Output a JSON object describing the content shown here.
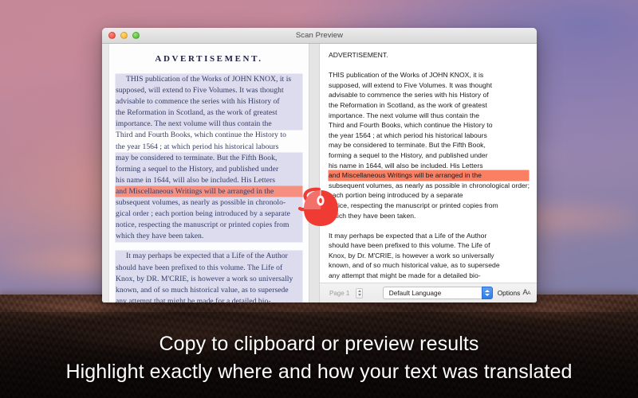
{
  "window": {
    "title": "Scan Preview",
    "traffic_lights": [
      "close-button",
      "minimize-button",
      "zoom-button"
    ]
  },
  "scan_pane": {
    "heading": "ADVERTISEMENT.",
    "paragraphs": [
      {
        "lines": [
          {
            "text": "THIS publication of the Works of JOHN KNOX, it is",
            "highlight": "blue",
            "indent": true
          },
          {
            "text": "supposed, will extend to Five Volumes.   It was thought",
            "highlight": "blue"
          },
          {
            "text": "advisable to commence the series with his History of",
            "highlight": "blue"
          },
          {
            "text": "the Reformation in Scotland, as the work of greatest",
            "highlight": "blue"
          },
          {
            "text": "importance.    The next volume will thus contain the",
            "highlight": "blue"
          },
          {
            "text": "Third and Fourth Books, which continue the History to",
            "highlight": "none"
          },
          {
            "text": "the year 1564 ; at which period his historical labours",
            "highlight": "none"
          },
          {
            "text": "may be considered to terminate.   But the Fifth Book,",
            "highlight": "blue"
          },
          {
            "text": "forming a sequel to the History, and published under",
            "highlight": "blue"
          },
          {
            "text": "his name in 1644, will also be included.   His Letters",
            "highlight": "blue"
          },
          {
            "text": "and Miscellaneous Writings will be arranged in the",
            "highlight": "red"
          },
          {
            "text": "subsequent volumes, as nearly as possible in chronolo-",
            "highlight": "blue"
          },
          {
            "text": "gical order ; each portion being introduced by a separate",
            "highlight": "blue"
          },
          {
            "text": "notice, respecting the manuscript or printed copies from",
            "highlight": "blue"
          },
          {
            "text": "which they have been taken.",
            "highlight": "blue"
          }
        ]
      },
      {
        "lines": [
          {
            "text": "It may perhaps be expected that a Life of the Author",
            "highlight": "blue",
            "indent": true
          },
          {
            "text": "should have been prefixed to this volume.   The Life of",
            "highlight": "blue"
          },
          {
            "text": "Knox, by DR. M'CRIE, is however a work so universally",
            "highlight": "blue"
          },
          {
            "text": "known, and of so much historical value, as to supersede",
            "highlight": "blue"
          },
          {
            "text": "any attempt that might be made for a detailed bio-",
            "highlight": "blue"
          }
        ]
      }
    ]
  },
  "ocr_pane": {
    "heading": "ADVERTISEMENT.",
    "paragraphs": [
      {
        "lines": [
          {
            "text": "THIS publication of the Works of JOHN KNOX, it is",
            "highlight": "none"
          },
          {
            "text": "supposed, will extend to Five Volumes. It was thought",
            "highlight": "none"
          },
          {
            "text": "advisable to commence the series with his History of",
            "highlight": "none"
          },
          {
            "text": "the Reformation in Scotland, as the work of greatest",
            "highlight": "none"
          },
          {
            "text": "importance. The next volume will thus contain the",
            "highlight": "none"
          },
          {
            "text": "Third and Fourth Books, which continue the History to",
            "highlight": "none"
          },
          {
            "text": "the year 1564 ; at which period his historical labours",
            "highlight": "none"
          },
          {
            "text": "may be considered to terminate. But the Fifth Book,",
            "highlight": "none"
          },
          {
            "text": "forming a sequel to the History, and published under",
            "highlight": "none"
          },
          {
            "text": "his name in 1644, will also be included. His Letters",
            "highlight": "none"
          },
          {
            "text": "and Miscellaneous Writings will be arranged in the",
            "highlight": "red"
          },
          {
            "text": "subsequent volumes, as nearly as possible in chronological order;",
            "highlight": "none"
          },
          {
            "text": "each portion being introduced by a separate",
            "highlight": "none"
          },
          {
            "text": "notice, respecting the manuscript or printed copies from",
            "highlight": "none"
          },
          {
            "text": "which they have been taken.",
            "highlight": "none"
          }
        ]
      },
      {
        "lines": [
          {
            "text": "It may perhaps be expected that a Life of the Author",
            "highlight": "none"
          },
          {
            "text": "should have been prefixed to this volume. The Life of",
            "highlight": "none"
          },
          {
            "text": "Knox, by Dr. M'CRIE, is however a work so universally",
            "highlight": "none"
          },
          {
            "text": "known, and of so much historical value, as to supersede",
            "highlight": "none"
          },
          {
            "text": "any attempt that might be made for a detailed bio-",
            "highlight": "none"
          }
        ]
      }
    ]
  },
  "toolbar": {
    "page_value": "Page 1",
    "language_value": "Default Language",
    "options_label": "Options",
    "options_icon": "text-size-icon",
    "accent_color": "#2f7ce8"
  },
  "caption": {
    "line1": "Copy to clipboard or preview results",
    "line2": "Highlight exactly where and how your text was translated"
  },
  "overlay": {
    "mouse_icon": "computer-mouse-icon",
    "mouse_color": "#ef3b33"
  },
  "colors": {
    "highlight_blue": "#dcdcee",
    "highlight_red_scan": "#f58f80",
    "highlight_red_ocr": "#fb7f63",
    "window_chrome": "#e9e9e9"
  }
}
